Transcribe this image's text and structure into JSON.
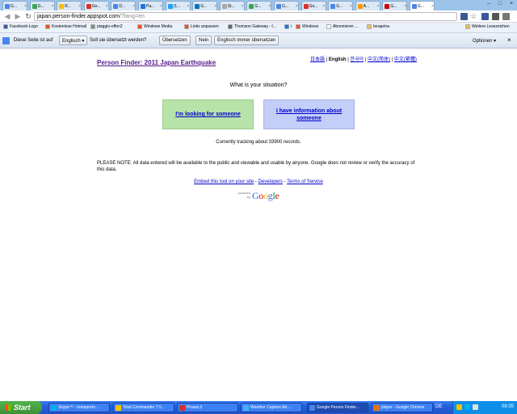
{
  "tabs": [
    {
      "label": "G...",
      "color": "#4a86e8"
    },
    {
      "label": "G...",
      "color": "#34a853"
    },
    {
      "label": "R...",
      "color": "#fbbc05"
    },
    {
      "label": "Go...",
      "color": "#d93025"
    },
    {
      "label": "D...",
      "color": "#4a86e8"
    },
    {
      "label": "Pa...",
      "color": "#1a73e8"
    },
    {
      "label": "(1...",
      "color": "#1da1f2"
    },
    {
      "label": "G...",
      "color": "#0077b5"
    },
    {
      "label": "St...",
      "color": "#aaaaaa"
    },
    {
      "label": "G...",
      "color": "#34a853"
    },
    {
      "label": "G...",
      "color": "#4a86e8"
    },
    {
      "label": "Go...",
      "color": "#d93025"
    },
    {
      "label": "G...",
      "color": "#4a86e8"
    },
    {
      "label": "A...",
      "color": "#ff9900"
    },
    {
      "label": "G...",
      "color": "#cc0000"
    },
    {
      "label": "G...",
      "color": "#4a86e8"
    }
  ],
  "address": {
    "host": "japan.person-finder.appspot.com",
    "path": "/?lang=en"
  },
  "bookmarks": [
    {
      "label": "Facebook-Logo",
      "color": "#3b5998"
    },
    {
      "label": "Kostenlose Hotmail",
      "color": "#f25022"
    },
    {
      "label": "piaggio-offen2",
      "color": "#888888"
    },
    {
      "label": "Windows Media",
      "color": "#f25022"
    },
    {
      "label": "Links anpassen",
      "color": "#f25022"
    },
    {
      "label": "Thomson Gateway - I...",
      "color": "#666666"
    },
    {
      "label": "i",
      "color": "#1a73e8"
    },
    {
      "label": "Windows",
      "color": "#f25022"
    },
    {
      "label": "Abonnieren ...",
      "color": "#ffffff"
    },
    {
      "label": "Ierapetra",
      "color": "#e8c060"
    },
    {
      "label": "Weitere Lesezeichen",
      "color": "#e8c060"
    }
  ],
  "translate_bar": {
    "prefix": "Diese Seite ist auf",
    "language": "Englisch ▾",
    "question": "Soll sie übersetzt werden?",
    "translate_btn": "Übersetzen",
    "no_btn": "Nein",
    "always_btn": "Englisch immer übersetzen",
    "options": "Optionen ▾"
  },
  "page": {
    "lang_links": {
      "a": "日本語",
      "current": "English",
      "b": "한국어",
      "c": "中文(简体)",
      "d": "中文(繁體)"
    },
    "brand": "Person Finder: 2011 Japan Earthquake",
    "question": "What is your situation?",
    "seek_label": "I'm looking for someone",
    "provide_label": "I have information about someone",
    "tracking": "Currently tracking about 33900 records.",
    "note": "PLEASE NOTE: All data entered will be available to the public and viewable and usable by anyone. Google does not review or verify the accuracy of this data.",
    "embed_link": "Embed this tool on your site",
    "developers_link": "Developers",
    "tos_link": "Terms of Service",
    "powered_by": "powered by",
    "google_logo": [
      "G",
      "o",
      "o",
      "g",
      "l",
      "e"
    ]
  },
  "taskbar": {
    "start": "Start",
    "tasks": [
      {
        "label": "Skype™ - kretaporto...",
        "color": "#00aff0"
      },
      {
        "label": "Total Commander 7.5...",
        "color": "#f2c200"
      },
      {
        "label": "Picasa 3",
        "color": "#d93025"
      },
      {
        "label": "Weather Capture Ad...",
        "color": "#43b0f5"
      },
      {
        "label": "Google Person Finder...",
        "color": "#4a86e8"
      },
      {
        "label": "player - Google Chrome",
        "color": "#e8710a"
      }
    ],
    "lang": "DE",
    "clock": "08:35"
  },
  "colors": {
    "logo": [
      "#3369e8",
      "#d50f25",
      "#eeb211",
      "#3369e8",
      "#009925",
      "#d50f25"
    ]
  }
}
